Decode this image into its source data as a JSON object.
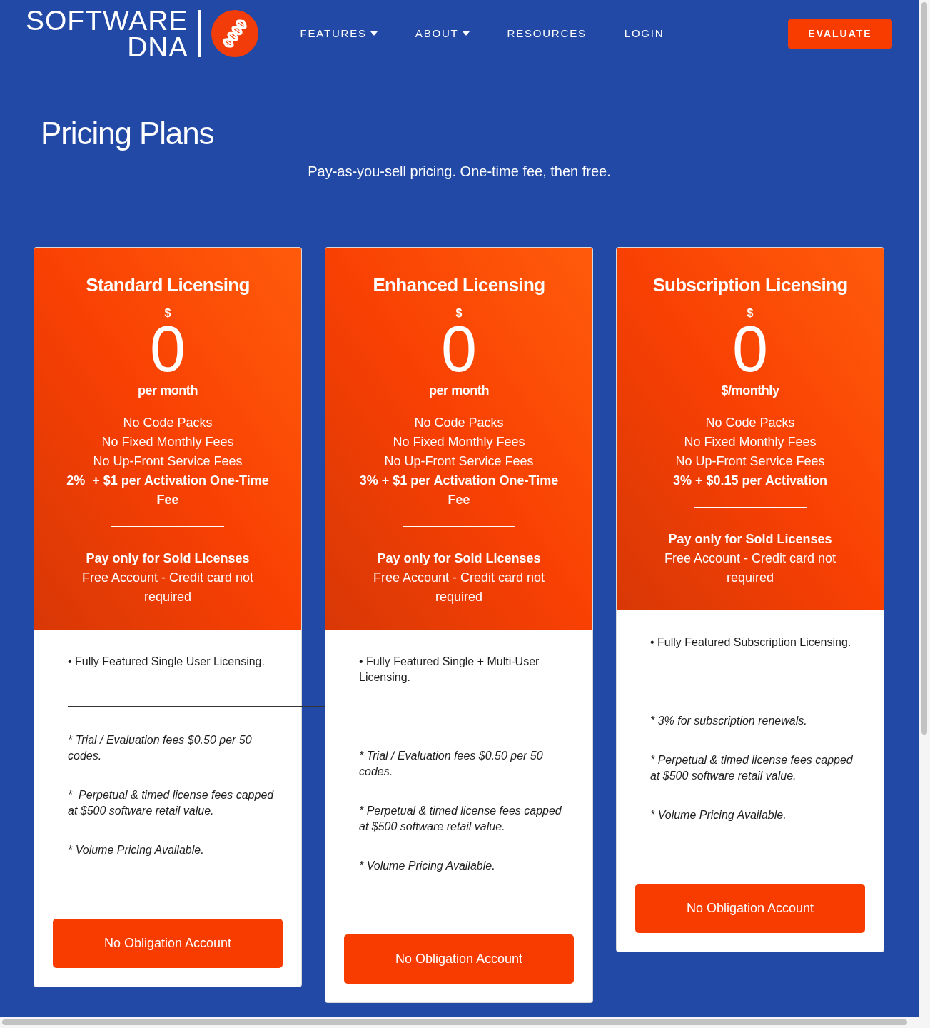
{
  "header": {
    "logo": [
      "SOFTWARE",
      "DNA"
    ],
    "nav": [
      {
        "label": "FEATURES",
        "has_dropdown": true
      },
      {
        "label": "ABOUT",
        "has_dropdown": true
      },
      {
        "label": "RESOURCES",
        "has_dropdown": false
      },
      {
        "label": "LOGIN",
        "has_dropdown": false
      }
    ],
    "cta": "EVALUATE"
  },
  "hero": {
    "title": "Pricing Plans",
    "subtitle": "Pay-as-you-sell pricing. One-time fee, then free."
  },
  "plans": [
    {
      "title": "Standard Licensing",
      "currency": "$",
      "price": "0",
      "period": "per month",
      "features": [
        "No Code Packs",
        "No Fixed Monthly Fees",
        "No Up-Front Service Fees"
      ],
      "fee": "2%  + $1 per Activation One-Time Fee",
      "highlight": "Pay only for Sold Licenses",
      "note": "Free Account - Credit card not required",
      "details": "• Fully Featured Single User Licensing.",
      "footnotes": [
        "* Trial / Evaluation fees $0.50 per 50 codes.",
        "*  Perpetual & timed license fees capped at $500 software retail value.",
        "* Volume Pricing Available."
      ],
      "button": "No Obligation Account"
    },
    {
      "title": "Enhanced Licensing",
      "currency": "$",
      "price": "0",
      "period": "per month",
      "features": [
        "No Code Packs",
        "No Fixed Monthly Fees",
        "No Up-Front Service Fees"
      ],
      "fee": "3% + $1 per Activation One-Time Fee",
      "highlight": "Pay only for Sold Licenses",
      "note": "Free Account - Credit card not required",
      "details": "• Fully Featured Single + Multi-User Licensing.",
      "footnotes": [
        "* Trial / Evaluation fees $0.50 per 50 codes.",
        "* Perpetual & timed license fees capped at $500 software retail value.",
        "* Volume Pricing Available."
      ],
      "button": "No Obligation Account"
    },
    {
      "title": "Subscription Licensing",
      "currency": "$",
      "price": "0",
      "period": "$/monthly",
      "features": [
        "No Code Packs",
        "No Fixed Monthly Fees",
        "No Up-Front Service Fees"
      ],
      "fee": "3% + $0.15 per Activation",
      "highlight": "Pay only for Sold Licenses",
      "note": "Free Account - Credit card not required",
      "details": "• Fully Featured Subscription Licensing.",
      "footnotes": [
        "* 3% for subscription renewals.",
        "* Perpetual & timed license fees capped at $500 software retail value.",
        "* Volume Pricing Available."
      ],
      "button": "No Obligation Account"
    }
  ]
}
